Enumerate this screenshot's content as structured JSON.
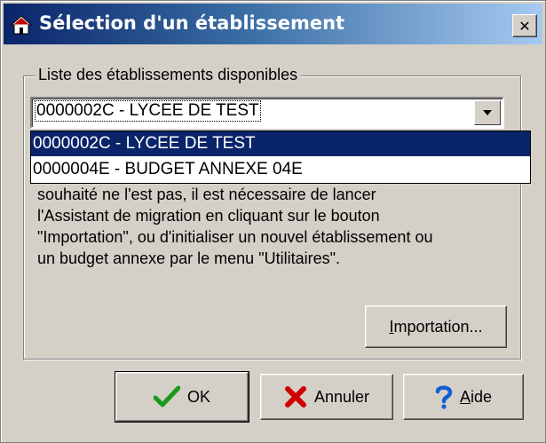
{
  "window": {
    "title": "Sélection d'un établissement",
    "close_glyph": "✕"
  },
  "group": {
    "legend": "Liste des établissements disponibles"
  },
  "combo": {
    "value": "0000002C - LYCEE DE TEST"
  },
  "dropdown": {
    "items": [
      "0000002C - LYCEE DE TEST",
      "0000004E - BUDGET ANNEXE 04E"
    ],
    "selected_index": 0
  },
  "description": {
    "lines": [
      "souhaité ne l'est pas, il est nécessaire de lancer",
      "l'Assistant de migration en cliquant sur le bouton",
      "\"Importation\", ou d'initialiser un nouvel établissement ou",
      "un budget annexe par le menu \"Utilitaires\"."
    ]
  },
  "buttons": {
    "import_first": "I",
    "import_rest": "mportation...",
    "ok": "OK",
    "cancel": "Annuler",
    "help_first": "A",
    "help_rest": "ide"
  },
  "icons": {
    "title": "home-icon",
    "ok": "checkmark-icon",
    "cancel": "red-x-icon",
    "help": "question-icon"
  },
  "colors": {
    "title_start": "#0a246a",
    "title_end": "#a6caf0",
    "selection": "#0a246a",
    "face": "#d4d0c8"
  }
}
